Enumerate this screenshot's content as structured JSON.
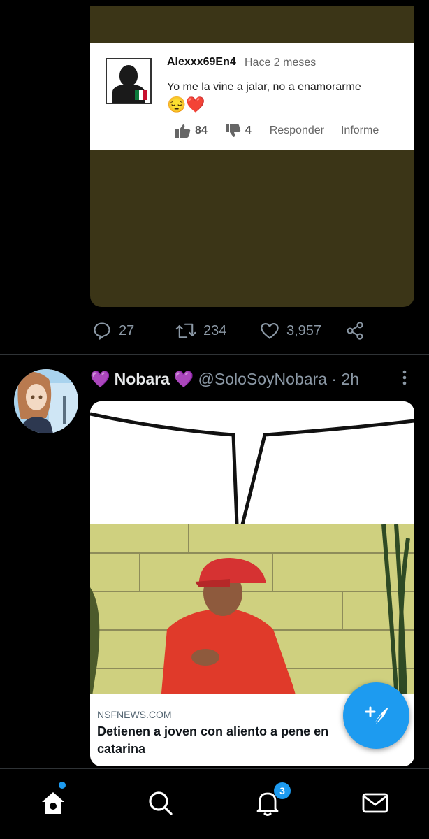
{
  "first_tweet": {
    "comment": {
      "username": "Alexxx69En4",
      "time": "Hace 2 meses",
      "text": "Yo me la vine a jalar, no a enamorarme",
      "emoji": "😔❤️",
      "likes": "84",
      "dislikes": "4",
      "reply_label": "Responder",
      "report_label": "Informe"
    },
    "actions": {
      "replies": "27",
      "retweets": "234",
      "likes": "3,957"
    }
  },
  "second_tweet": {
    "heart_emoji": "💜",
    "display_name": "Nobara",
    "handle_time": "@SoloSoyNobara · 2h",
    "card": {
      "domain": "NSFNEWS.COM",
      "title": "Detienen a joven con aliento a pene en catarina"
    }
  },
  "bottom_nav": {
    "notifications_badge": "3"
  },
  "colors": {
    "accent": "#1d9bf0",
    "background": "#000000",
    "muted": "#8b98a5"
  },
  "icons": [
    "comment-icon",
    "retweet-icon",
    "heart-icon",
    "share-icon",
    "more-icon",
    "compose-icon",
    "home-icon",
    "search-icon",
    "bell-icon",
    "mail-icon",
    "thumbs-up-icon",
    "thumbs-down-icon"
  ]
}
